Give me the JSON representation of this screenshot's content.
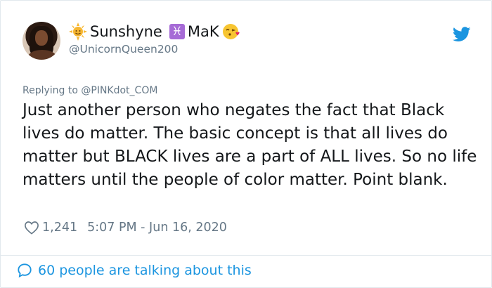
{
  "user": {
    "display_name": "Sunshyne",
    "display_name_suffix": "MaK",
    "handle": "@UnicornQueen200",
    "emoji_icons": [
      "sun-with-face-icon",
      "pisces-icon",
      "face-blowing-kiss-icon"
    ]
  },
  "tweet": {
    "replying_to": "Replying to @PINKdot_COM",
    "text": "Just another person who negates the fact that Black lives do matter. The basic concept is that all lives do matter but BLACK lives are a part of ALL lives. So no life matters until the people of color matter. Point blank.",
    "likes": "1,241",
    "timestamp": "5:07 PM - Jun 16, 2020"
  },
  "footer": {
    "talking_label": "60 people are talking about this"
  },
  "colors": {
    "twitter_blue": "#1b95e0",
    "secondary_text": "#657786",
    "border": "#e1e8ed"
  }
}
